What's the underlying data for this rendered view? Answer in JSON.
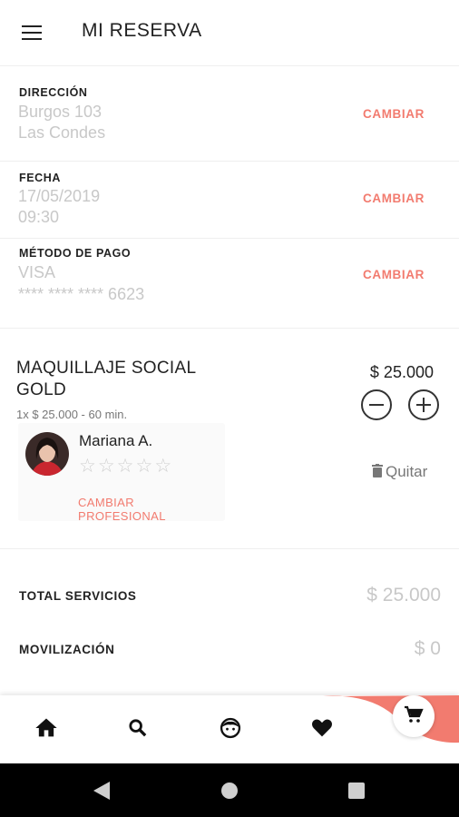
{
  "app_bar": {
    "title": "MI RESERVA"
  },
  "address": {
    "label": "DIRECCIÓN",
    "line1": "Burgos 103",
    "line2": "Las Condes",
    "change": "CAMBIAR"
  },
  "date": {
    "label": "FECHA",
    "line1": "17/05/2019",
    "line2": "09:30",
    "change": "CAMBIAR"
  },
  "payment": {
    "label": "MÉTODO DE PAGO",
    "line1": "VISA",
    "line2": "**** **** **** 6623",
    "change": "CAMBIAR"
  },
  "service": {
    "name": "MAQUILLAJE SOCIAL GOLD",
    "detail": "1x $ 25.000 - 60 min.",
    "price": "$ 25.000",
    "professional": {
      "name": "Mariana A.",
      "rating": 0,
      "change": "CAMBIAR PROFESIONAL"
    },
    "remove": "Quitar"
  },
  "totals": [
    {
      "label": "TOTAL SERVICIOS",
      "value": "$ 25.000"
    },
    {
      "label": "MOVILIZACIÓN",
      "value": "$ 0"
    }
  ],
  "bottom_nav": {
    "items": [
      "home-icon",
      "search-icon",
      "face-icon",
      "heart-icon",
      "cart-icon"
    ],
    "active": "cart-icon"
  },
  "colors": {
    "accent": "#f27b6f",
    "muted": "#c8c8c8",
    "text": "#222222"
  }
}
